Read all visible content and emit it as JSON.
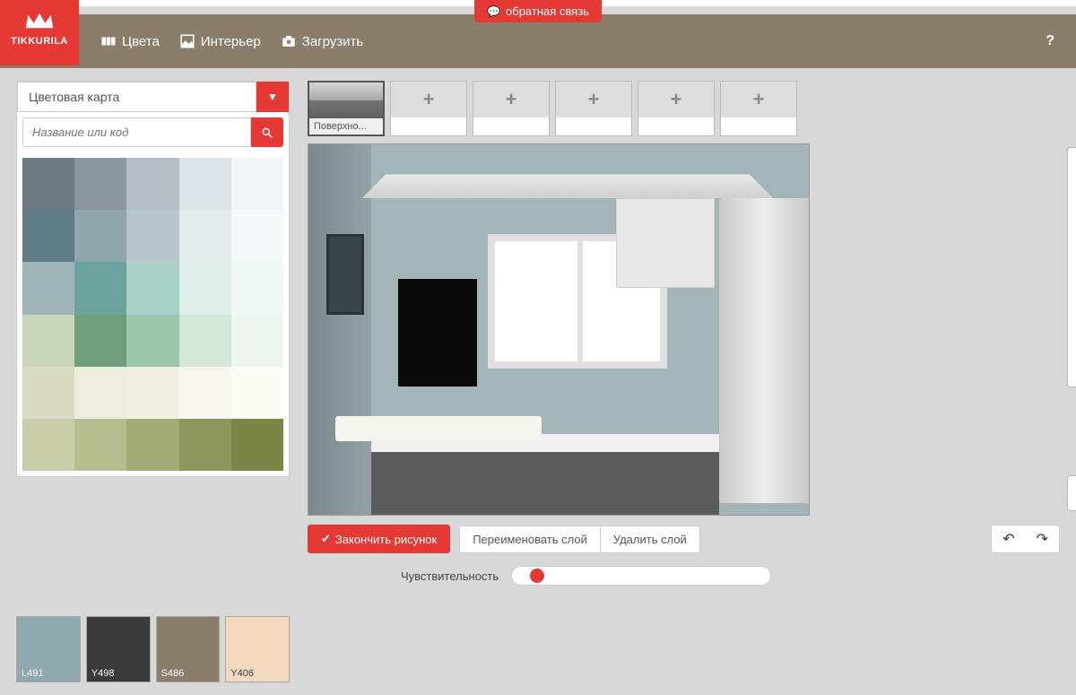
{
  "feedback": "обратная связь",
  "brand": "TIKKURILA",
  "nav": {
    "colors": "Цвета",
    "interior": "Интерьер",
    "upload": "Загрузить",
    "help": "?"
  },
  "colorMap": {
    "dropdown": "Цветовая карта",
    "searchPlaceholder": "Название или код"
  },
  "swatches": [
    "#6c7a82",
    "#8b96a0",
    "#b5bec4",
    "#dde3e6",
    "#f2f5f7",
    "#5e7b86",
    "#8fa6af",
    "#b7c6cb",
    "#e3ebed",
    "#f5f9fa",
    "#9fb5b8",
    "#6ba3a0",
    "#a9d0c6",
    "#dfeee9",
    "#f0f8f5",
    "#c9d4b8",
    "#6fa07b",
    "#9bc7a8",
    "#d2e7d8",
    "#eef6ef",
    "#d9dac3",
    "#edeee0",
    "#f0f0e5",
    "#f7f7ef",
    "#fbfbf5",
    "#c9cda8",
    "#b6bd8f",
    "#a2ab76",
    "#8e985e",
    "#7a8546"
  ],
  "selectedColors": [
    {
      "code": "L491",
      "hex": "#8fa8ad"
    },
    {
      "code": "Y498",
      "hex": "#3a3a3a"
    },
    {
      "code": "S486",
      "hex": "#8a7d6a"
    },
    {
      "code": "Y406",
      "hex": "#f2d9c0"
    }
  ],
  "surfaces": {
    "activeLabel": "Поверхно..."
  },
  "actions": {
    "finish": "Закончить рисунок",
    "rename": "Переименовать слой",
    "delete": "Удалить слой"
  },
  "sensitivity": {
    "label": "Чувствительность"
  },
  "tools": [
    "fill",
    "line",
    "brush",
    "erase",
    "zoom-in",
    "zoom-out",
    "move"
  ],
  "eyedropper": "eyedropper"
}
